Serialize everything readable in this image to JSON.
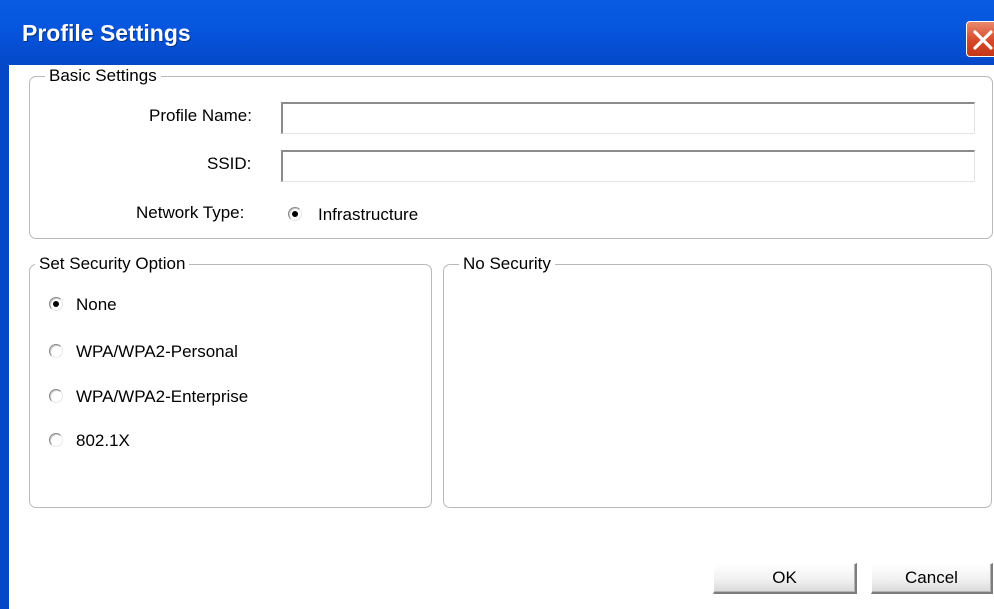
{
  "window": {
    "title": "Profile Settings",
    "close_icon": "close-icon"
  },
  "basic_settings": {
    "legend": "Basic Settings",
    "profile_name_label": "Profile Name:",
    "profile_name_value": "",
    "ssid_label": "SSID:",
    "ssid_value": "",
    "network_type_label": "Network Type:",
    "network_type_option": "Infrastructure",
    "network_type_selected": true
  },
  "security_option": {
    "legend": "Set Security Option",
    "options": [
      {
        "label": "None",
        "selected": true
      },
      {
        "label": "WPA/WPA2-Personal",
        "selected": false
      },
      {
        "label": "WPA/WPA2-Enterprise",
        "selected": false
      },
      {
        "label": "802.1X",
        "selected": false
      }
    ]
  },
  "security_detail": {
    "legend": "No Security"
  },
  "buttons": {
    "ok": "OK",
    "cancel": "Cancel"
  },
  "colors": {
    "titlebar": "#0656df",
    "close_button": "#d8482a",
    "group_border": "#b9b9b9"
  }
}
